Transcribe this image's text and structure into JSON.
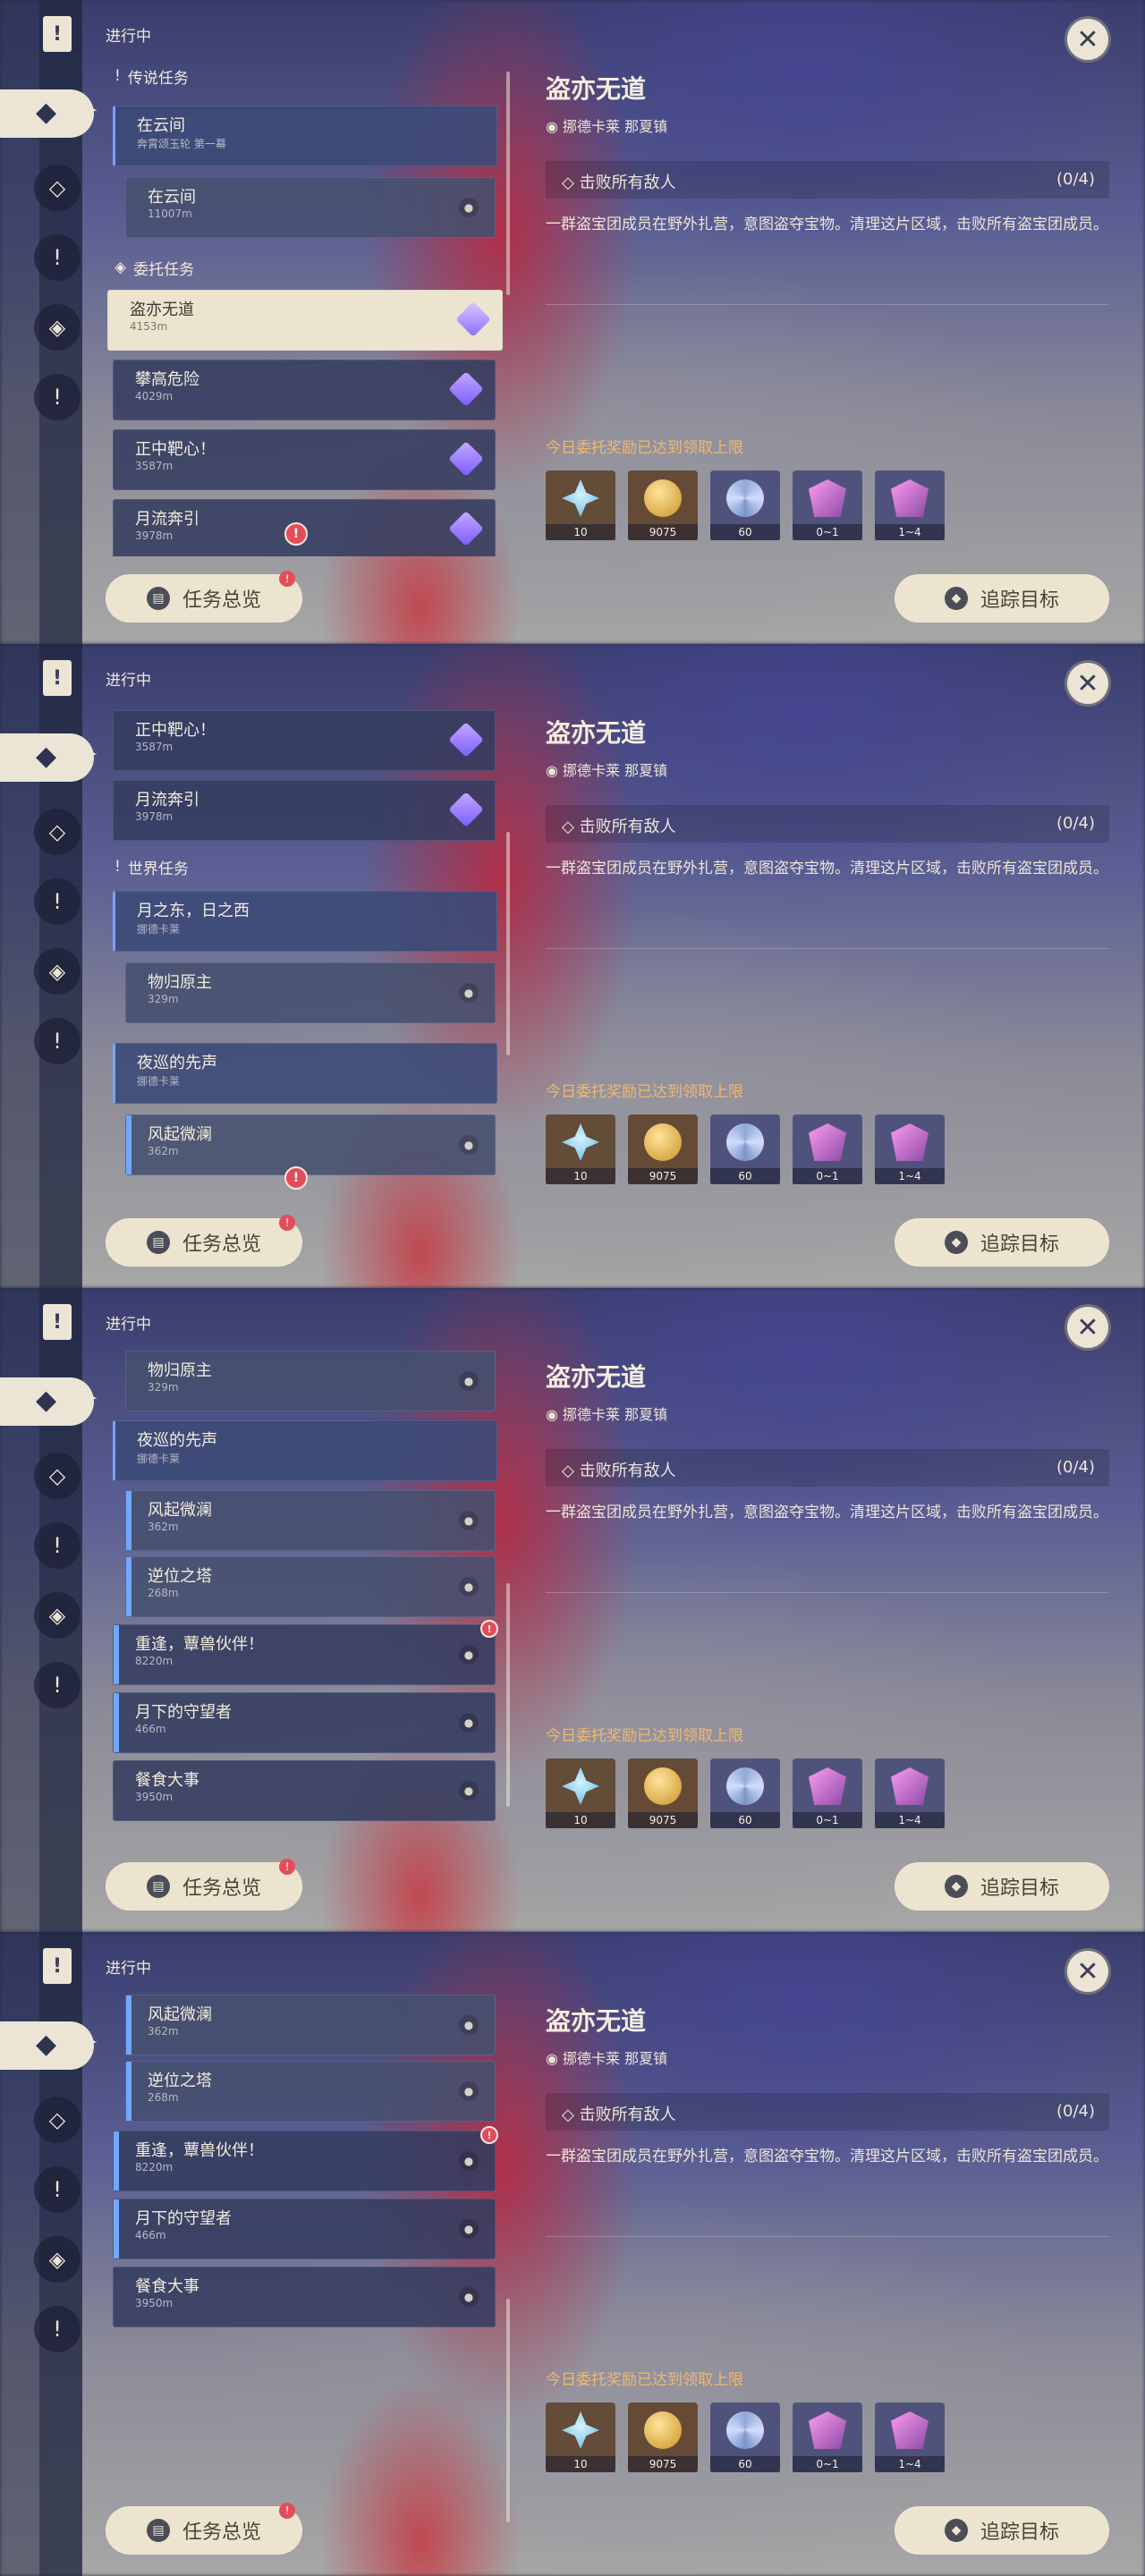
{
  "common": {
    "header_label": "进行中",
    "overview_button": "任务总览",
    "track_button": "追踪目标",
    "close_symbol": "✕",
    "detail": {
      "title": "盗亦无道",
      "location": "挪德卡莱 那夏镇",
      "objective": "击败所有敌人",
      "progress": "(0/4)",
      "description": "一群盗宝团成员在野外扎营，意图盗夺宝物。清理这片区域，击败所有盗宝团成员。",
      "limit_text": "今日委托奖励已达到领取上限",
      "rewards": [
        {
          "icon": "primogem-icon",
          "count": "10"
        },
        {
          "icon": "mora-icon",
          "count": "9075"
        },
        {
          "icon": "exp-icon",
          "count": "60"
        },
        {
          "icon": "gem-icon",
          "count": "0~1"
        },
        {
          "icon": "gem-icon",
          "count": "1~4"
        }
      ]
    }
  },
  "frames": [
    {
      "sections": [
        {
          "title": "传说任务"
        },
        {
          "title": "委托任务"
        }
      ],
      "cards": [
        {
          "label": "在云间",
          "sub": "奔霄颂玉轮 第一幕",
          "type": "parent"
        },
        {
          "label": "在云间",
          "sub": "11007m",
          "type": "sub"
        },
        {
          "label": "盗亦无道",
          "sub": "4153m",
          "type": "selected"
        },
        {
          "label": "攀高危险",
          "sub": "4029m",
          "type": "normal"
        },
        {
          "label": "正中靶心！",
          "sub": "3587m",
          "type": "normal"
        },
        {
          "label": "月流奔引",
          "sub": "3978m",
          "type": "normal"
        }
      ]
    },
    {
      "sections": [
        {
          "title": "世界任务"
        }
      ],
      "cards": [
        {
          "label": "正中靶心！",
          "sub": "3587m",
          "type": "normal"
        },
        {
          "label": "月流奔引",
          "sub": "3978m",
          "type": "normal"
        },
        {
          "label": "月之东，日之西",
          "sub": "挪德卡莱",
          "type": "parent"
        },
        {
          "label": "物归原主",
          "sub": "329m",
          "type": "sub"
        },
        {
          "label": "夜巡的先声",
          "sub": "挪德卡莱",
          "type": "parent"
        },
        {
          "label": "风起微澜",
          "sub": "362m",
          "type": "sub"
        }
      ]
    },
    {
      "cards": [
        {
          "label": "物归原主",
          "sub": "329m",
          "type": "sub"
        },
        {
          "label": "夜巡的先声",
          "sub": "挪德卡莱",
          "type": "parent"
        },
        {
          "label": "风起微澜",
          "sub": "362m",
          "type": "sub"
        },
        {
          "label": "逆位之塔",
          "sub": "268m",
          "type": "sub"
        },
        {
          "label": "重逢，蕈兽伙伴！",
          "sub": "8220m",
          "type": "normal"
        },
        {
          "label": "月下的守望者",
          "sub": "466m",
          "type": "normal"
        },
        {
          "label": "餐食大事",
          "sub": "3950m",
          "type": "normal"
        }
      ]
    },
    {
      "cards": [
        {
          "label": "风起微澜",
          "sub": "362m",
          "type": "sub"
        },
        {
          "label": "逆位之塔",
          "sub": "268m",
          "type": "sub"
        },
        {
          "label": "重逢，蕈兽伙伴！",
          "sub": "8220m",
          "type": "normal"
        },
        {
          "label": "月下的守望者",
          "sub": "466m",
          "type": "normal"
        },
        {
          "label": "餐食大事",
          "sub": "3950m",
          "type": "normal"
        }
      ]
    }
  ]
}
